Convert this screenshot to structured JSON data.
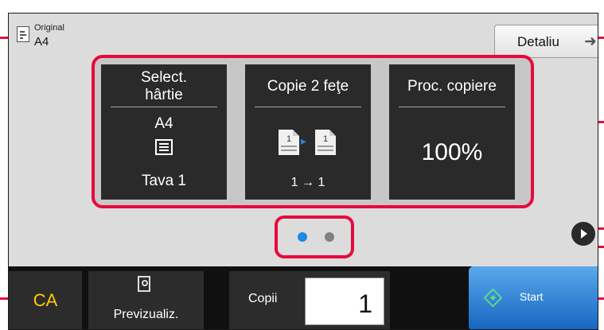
{
  "original": {
    "label": "Original",
    "size": "A4"
  },
  "detail_button": {
    "label": "Detaliu",
    "icon": "arrow-right-icon"
  },
  "tiles": [
    {
      "title_line1": "Select.",
      "title_line2": "hârtie",
      "size": "A4",
      "icon": "paper-tray-icon",
      "value": "Tava 1"
    },
    {
      "title": "Copie 2 feţe",
      "page_left": "1",
      "page_right": "1",
      "icon": "duplex-copy-icon",
      "value": "1 → 1"
    },
    {
      "title": "Proc. copiere",
      "value": "100%"
    }
  ],
  "page_indicator": {
    "pages": 2,
    "current": 1,
    "active_color": "#1e88e5",
    "inactive_color": "#808080"
  },
  "next_button": {
    "icon": "chevron-right-icon"
  },
  "bottom_bar": {
    "clear_all": "CA",
    "preview": "Previzualiz.",
    "copies_label": "Copii",
    "copies_value": "1",
    "start": "Start"
  },
  "colors": {
    "highlight": "#e60a3c",
    "ca_text": "#ffcc00",
    "start_blue": "#1e88e5",
    "start_icon": "#5fd88f"
  }
}
